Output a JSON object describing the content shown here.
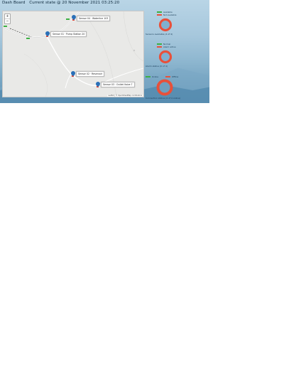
{
  "header": {
    "title": "Dash Board",
    "subtitle": "Current state @ 20 November 2021 03:25:20"
  },
  "map": {
    "zoom_in": "+",
    "zoom_out": "−",
    "attribution": "Leaflet | © OpenStreetMap contributors",
    "markers": [
      {
        "label": "Sensor 04 · Waterline 103"
      },
      {
        "label": "Sensor 01 · Pump Station 20"
      },
      {
        "label": "Sensor 02 · Reservoir"
      },
      {
        "label": "Sensor 03 · Outlet Valve 7"
      }
    ]
  },
  "gauges": [
    {
      "legend": [
        {
          "label": "Available",
          "color": "#3cb043"
        },
        {
          "label": "Not available",
          "color": "#e8503a"
        }
      ],
      "caption": "Sensors available (4 of 4)",
      "value": 0.0
    },
    {
      "legend": [
        {
          "label": "Normal",
          "color": "#3cb043"
        },
        {
          "label": "Alarm active",
          "color": "#e8503a"
        }
      ],
      "caption": "Alarm status (0 of 4)",
      "value": 0.0
    },
    {
      "legend": [
        {
          "label": "Online",
          "color": "#3cb043"
        },
        {
          "label": "Offline",
          "color": "#e8503a"
        }
      ],
      "caption": "Connection status (4 of 4 online)",
      "value": 0.0
    }
  ],
  "colors": {
    "accent": "#e8503a",
    "ok": "#3cb043",
    "marker": "#2a70b8"
  }
}
